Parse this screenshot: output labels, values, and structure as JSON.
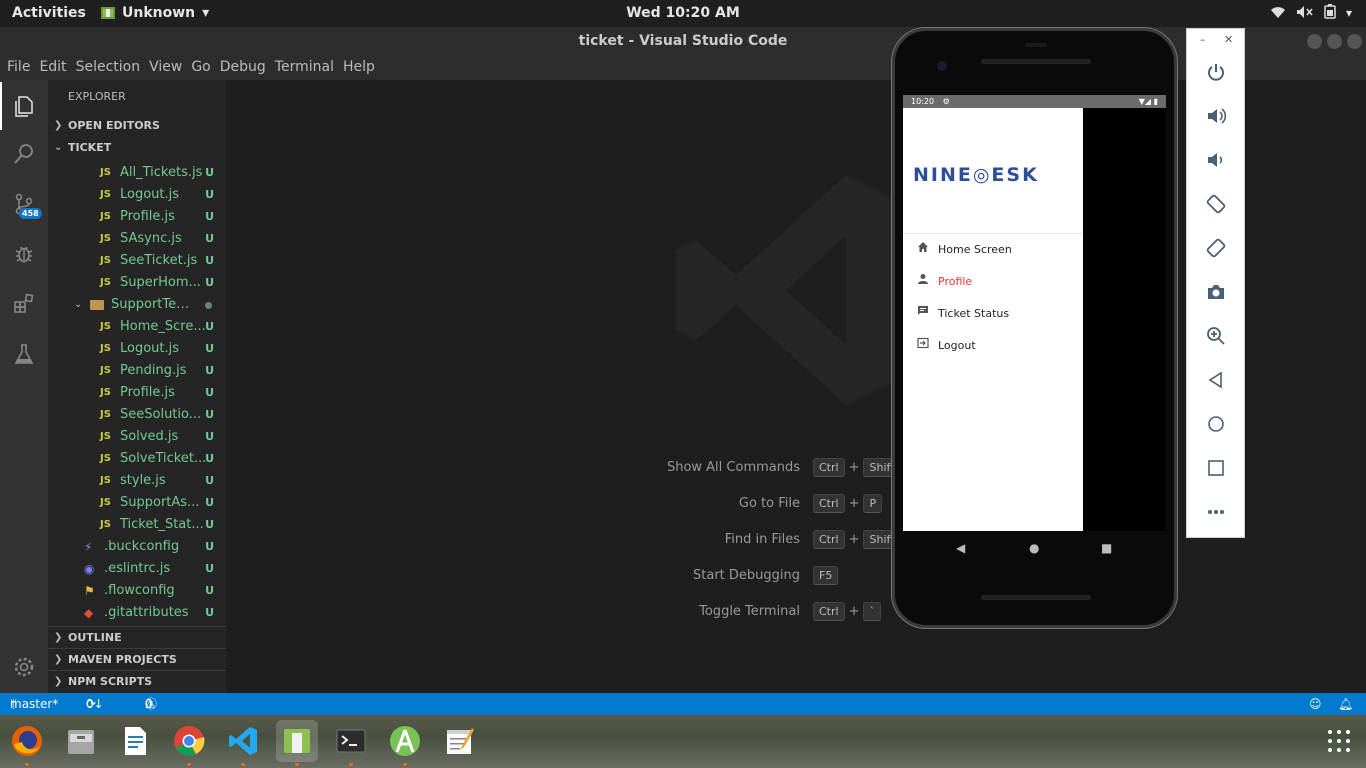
{
  "topbar": {
    "activities": "Activities",
    "app_name": "Unknown",
    "clock": "Wed 10:20 AM"
  },
  "window": {
    "title": "ticket - Visual Studio Code"
  },
  "menu": [
    "File",
    "Edit",
    "Selection",
    "View",
    "Go",
    "Debug",
    "Terminal",
    "Help"
  ],
  "activity": {
    "scm_badge": "458"
  },
  "sidebar": {
    "title": "EXPLORER",
    "open_editors": "OPEN EDITORS",
    "project": "TICKET",
    "outline": "OUTLINE",
    "maven": "MAVEN PROJECTS",
    "npm": "NPM SCRIPTS",
    "js_label": "JS",
    "status_u": "U",
    "files_group1": [
      {
        "name": "All_Tickets.js"
      },
      {
        "name": "Logout.js"
      },
      {
        "name": "Profile.js"
      },
      {
        "name": "SAsync.js"
      },
      {
        "name": "SeeTicket.js"
      },
      {
        "name": "SuperHom..."
      }
    ],
    "folder": "SupportTea...",
    "files_group2": [
      {
        "name": "Home_Scre..."
      },
      {
        "name": "Logout.js"
      },
      {
        "name": "Pending.js"
      },
      {
        "name": "Profile.js"
      },
      {
        "name": "SeeSolutio..."
      },
      {
        "name": "Solved.js"
      },
      {
        "name": "SolveTicket..."
      },
      {
        "name": "style.js"
      },
      {
        "name": "SupportAs..."
      },
      {
        "name": "Ticket_Stat..."
      }
    ],
    "dotfiles": [
      {
        "name": ".buckconfig"
      },
      {
        "name": ".eslintrc.js"
      },
      {
        "name": ".flowconfig"
      },
      {
        "name": ".gitattributes"
      }
    ]
  },
  "editor": {
    "shortcuts": [
      {
        "label": "Show All Commands",
        "keys": [
          "Ctrl",
          "+",
          "Shift"
        ]
      },
      {
        "label": "Go to File",
        "keys": [
          "Ctrl",
          "+",
          "P"
        ]
      },
      {
        "label": "Find in Files",
        "keys": [
          "Ctrl",
          "+",
          "Shift"
        ]
      },
      {
        "label": "Start Debugging",
        "keys": [
          "F5"
        ]
      },
      {
        "label": "Toggle Terminal",
        "keys": [
          "Ctrl",
          "+",
          "`"
        ]
      }
    ]
  },
  "statusbar": {
    "branch": "master*",
    "sync": "0↓ 1↑",
    "problems": "0",
    "warnings": "0"
  },
  "emulator": {
    "status_time": "10:20",
    "logo": "NINE◎ESK",
    "menu_items": [
      {
        "label": "Home Screen",
        "icon": "home-icon"
      },
      {
        "label": "Profile",
        "icon": "person-icon"
      },
      {
        "label": "Ticket Status",
        "icon": "message-icon"
      },
      {
        "label": "Logout",
        "icon": "logout-icon"
      }
    ],
    "active_item": "Profile"
  },
  "colors": {
    "accent_blue": "#007acc",
    "git_untracked": "#73c991",
    "drawer_active": "#ee3333",
    "logo_blue": "#2d4f9a"
  }
}
